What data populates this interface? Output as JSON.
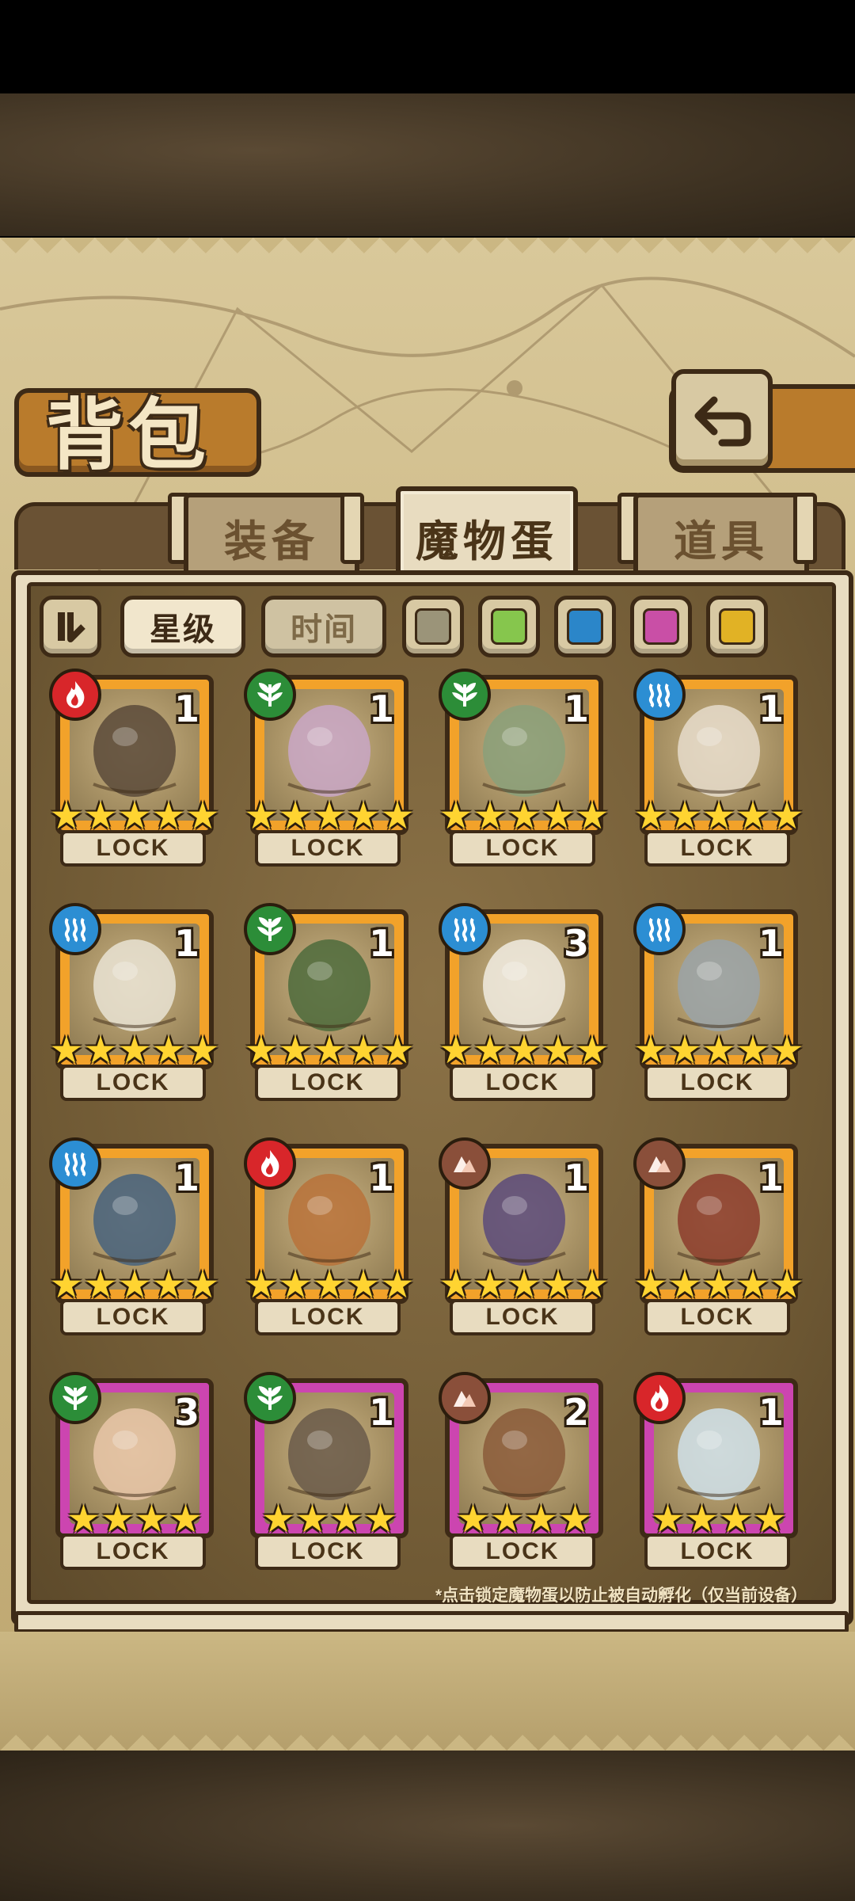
{
  "header": {
    "title": "背包"
  },
  "tabs": [
    {
      "label": "装备",
      "active": false
    },
    {
      "label": "魔物蛋",
      "active": true
    },
    {
      "label": "道具",
      "active": false
    }
  ],
  "filters": {
    "sort_icon": "sort-toggle-icon",
    "star_label": "星级",
    "time_label": "时间",
    "colors": [
      "#9b9479",
      "#86c64d",
      "#2b86c9",
      "#c94fa6",
      "#e1b225"
    ]
  },
  "cards": [
    {
      "element": "fire",
      "count": "1",
      "stars": "★★★★★",
      "rarity": "gold",
      "lock": "LOCK"
    },
    {
      "element": "leaf",
      "count": "1",
      "stars": "★★★★★",
      "rarity": "gold",
      "lock": "LOCK"
    },
    {
      "element": "leaf",
      "count": "1",
      "stars": "★★★★★",
      "rarity": "gold",
      "lock": "LOCK"
    },
    {
      "element": "water",
      "count": "1",
      "stars": "★★★★★",
      "rarity": "gold",
      "lock": "LOCK"
    },
    {
      "element": "water",
      "count": "1",
      "stars": "★★★★★",
      "rarity": "gold",
      "lock": "LOCK"
    },
    {
      "element": "leaf",
      "count": "1",
      "stars": "★★★★★",
      "rarity": "gold",
      "lock": "LOCK"
    },
    {
      "element": "water",
      "count": "3",
      "stars": "★★★★★",
      "rarity": "gold",
      "lock": "LOCK"
    },
    {
      "element": "water",
      "count": "1",
      "stars": "★★★★★",
      "rarity": "gold",
      "lock": "LOCK"
    },
    {
      "element": "water",
      "count": "1",
      "stars": "★★★★★",
      "rarity": "gold",
      "lock": "LOCK"
    },
    {
      "element": "fire",
      "count": "1",
      "stars": "★★★★★",
      "rarity": "gold",
      "lock": "LOCK"
    },
    {
      "element": "earth",
      "count": "1",
      "stars": "★★★★★",
      "rarity": "gold",
      "lock": "LOCK"
    },
    {
      "element": "earth",
      "count": "1",
      "stars": "★★★★★",
      "rarity": "gold",
      "lock": "LOCK"
    },
    {
      "element": "leaf",
      "count": "3",
      "stars": "★★★★",
      "rarity": "purple",
      "lock": "LOCK"
    },
    {
      "element": "leaf",
      "count": "1",
      "stars": "★★★★",
      "rarity": "purple",
      "lock": "LOCK"
    },
    {
      "element": "earth",
      "count": "2",
      "stars": "★★★★",
      "rarity": "purple",
      "lock": "LOCK"
    },
    {
      "element": "fire",
      "count": "1",
      "stars": "★★★★",
      "rarity": "purple",
      "lock": "LOCK"
    }
  ],
  "footnote": "*点击锁定魔物蛋以防止被自动孵化（仅当前设备）"
}
